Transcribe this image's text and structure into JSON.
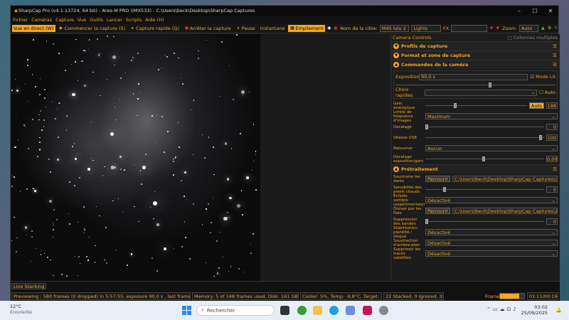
{
  "window": {
    "title": "SharpCap Pro (v4.1.13724, 64 bit) - Ares-M PRO (IMX533) - C:\\Users\\beck\\Desktop\\SharpCap Captures",
    "controls": [
      "–",
      "☐",
      "✕"
    ]
  },
  "menu": [
    "Fichier",
    "Caméras",
    "Capture",
    "Vue",
    "Outils",
    "Lancer",
    "Scripts",
    "Aide (H)"
  ],
  "toolbar": {
    "live_view": "Vue en direct (W)",
    "start_capture": "Commencer la capture (S)",
    "quick_capture": "Capture rapide (Q)",
    "stop_capture": "Arrêter la capture",
    "pause": "Pause",
    "snapshot": "Instantané",
    "stacking": "Empilement",
    "target_label": "Nom de la cible:",
    "target_value": "M45 lulu 2",
    "lights_value": "Lights",
    "fx_label": "FX",
    "zoom_label": "Zoom:",
    "zoom_value": "Auto"
  },
  "panel": {
    "title": "Camera Controls",
    "multi_columns": "Colonnes multiples",
    "sections": {
      "profiles": "Profils de capture",
      "format": "Format et zone de capture",
      "camera_controls": "Commandes de la caméra",
      "preprocessing": "Prétraitement"
    },
    "exposure_label": "Exposition",
    "exposure_value": "90,0 s",
    "mode_lx": "Mode LX",
    "quick_choice": "Choix rapides",
    "auto": "Auto",
    "analog_gain": "Gain analogique",
    "gain_auto": "Auto",
    "gain_value": "188",
    "freq_limit": "Limite de fréquence d'images",
    "freq_value": "Maximum",
    "offset": "Décalage",
    "offset_value": "0",
    "usb_speed": "Vitesse USB",
    "usb_value": "100",
    "flip": "Retourner",
    "flip_value": "Aucun",
    "exp_gain_offset": "Décalage exposition/gain",
    "exp_gain_value": "0,00",
    "subtract_darks": "Soustraire les darks",
    "browse": "Parcourir",
    "darks_path": "C:\\Users\\beck\\Desktop\\SharpCap Captures\\da...",
    "hot_pixels": "Sensibilité des pixels chauds",
    "hot_value": "5",
    "dark_scale": "Échelle sombre (expérimentale)",
    "dark_scale_value": "Désactivé",
    "divide_flats": "Diviser par les flats",
    "flats_path": "C:\\Users\\beck\\Desktop\\SharpCap Captures\\20...",
    "banding": "Suppression des bandes",
    "banding_value": "0",
    "flatness": "Stabilisation planéité / disque",
    "flatness_value": "Désactivé",
    "bg_subtract": "Soustraction d'arrière-plan",
    "bg_value": "Désactivé",
    "sat_trails": "Supprimer les traces satellites",
    "sat_value": "Désactivé"
  },
  "status": {
    "live_stacking_tab": "Live Stacking",
    "previewing": "Previewing : 580 frames (0 dropped) in 5:57:55, exposure 90,0 s , last frame 90,0s",
    "memory": "Memory: 5 of 148 frames used, Disk: 161 GB free",
    "cooler": "Cooler: 5%, Temp: -9,8°C, Target: -10,0°C",
    "stacked": "22 Stacked, 0 Ignored, 33m 0s",
    "frame_label": "Frame",
    "frame_time": "01:11/00:19",
    "frame_progress": 0.8
  },
  "taskbar": {
    "temp": "12°C",
    "weather": "Ensoleillé",
    "search_placeholder": "Rechercher",
    "time": "03:02",
    "date": "25/09/2025"
  },
  "colors": {
    "accent": "#f5a623",
    "bg": "#1a1a1a"
  }
}
